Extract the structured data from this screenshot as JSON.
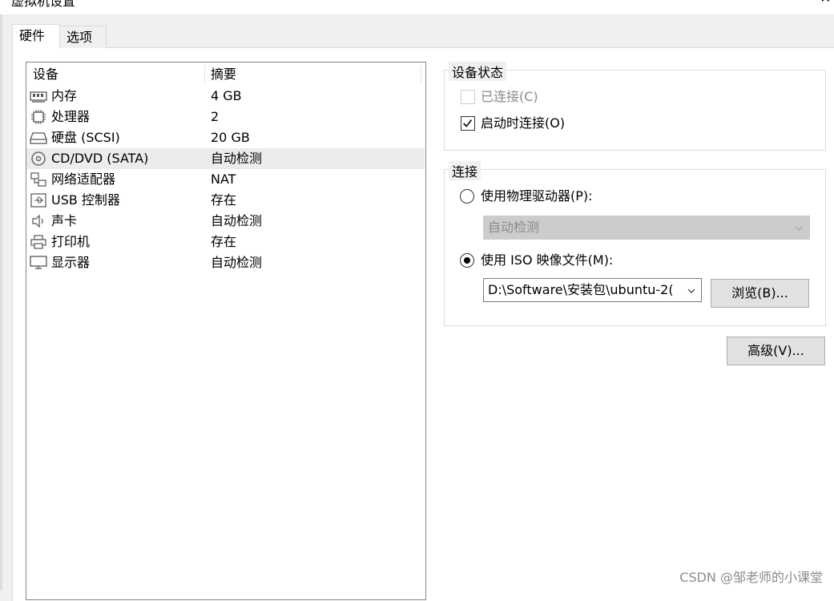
{
  "window": {
    "title": "虚拟机设置",
    "close_glyph": "✕"
  },
  "tabs": [
    {
      "label": "硬件",
      "active": true
    },
    {
      "label": "选项",
      "active": false
    }
  ],
  "device_list": {
    "columns": [
      "设备",
      "摘要"
    ],
    "rows": [
      {
        "icon": "memory-icon",
        "name": "内存",
        "summary": "4 GB"
      },
      {
        "icon": "processor-icon",
        "name": "处理器",
        "summary": "2"
      },
      {
        "icon": "hard-disk-icon",
        "name": "硬盘 (SCSI)",
        "summary": "20 GB"
      },
      {
        "icon": "cd-dvd-icon",
        "name": "CD/DVD (SATA)",
        "summary": "自动检测",
        "selected": true
      },
      {
        "icon": "network-adapter-icon",
        "name": "网络适配器",
        "summary": "NAT"
      },
      {
        "icon": "usb-icon",
        "name": "USB 控制器",
        "summary": "存在"
      },
      {
        "icon": "sound-card-icon",
        "name": "声卡",
        "summary": "自动检测"
      },
      {
        "icon": "printer-icon",
        "name": "打印机",
        "summary": "存在"
      },
      {
        "icon": "display-icon",
        "name": "显示器",
        "summary": "自动检测"
      }
    ]
  },
  "device_status": {
    "title": "设备状态",
    "connected": {
      "label": "已连接(C)",
      "checked": false,
      "enabled": false
    },
    "connect_at_power_on": {
      "label": "启动时连接(O)",
      "checked": true,
      "enabled": true
    }
  },
  "connection": {
    "title": "连接",
    "physical_drive": {
      "label": "使用物理驱动器(P):",
      "selected": false,
      "value": "自动检测"
    },
    "iso_image": {
      "label": "使用 ISO 映像文件(M):",
      "selected": true,
      "value": "D:\\Software\\安装包\\ubuntu-2("
    },
    "browse_button": "浏览(B)..."
  },
  "advanced_button": "高级(V)...",
  "watermark": "CSDN @邹老师的小课堂",
  "colors": {
    "selected_row": "#ececec",
    "disabled_text": "#8a8a8a",
    "button_bg": "#e1e1e1"
  }
}
